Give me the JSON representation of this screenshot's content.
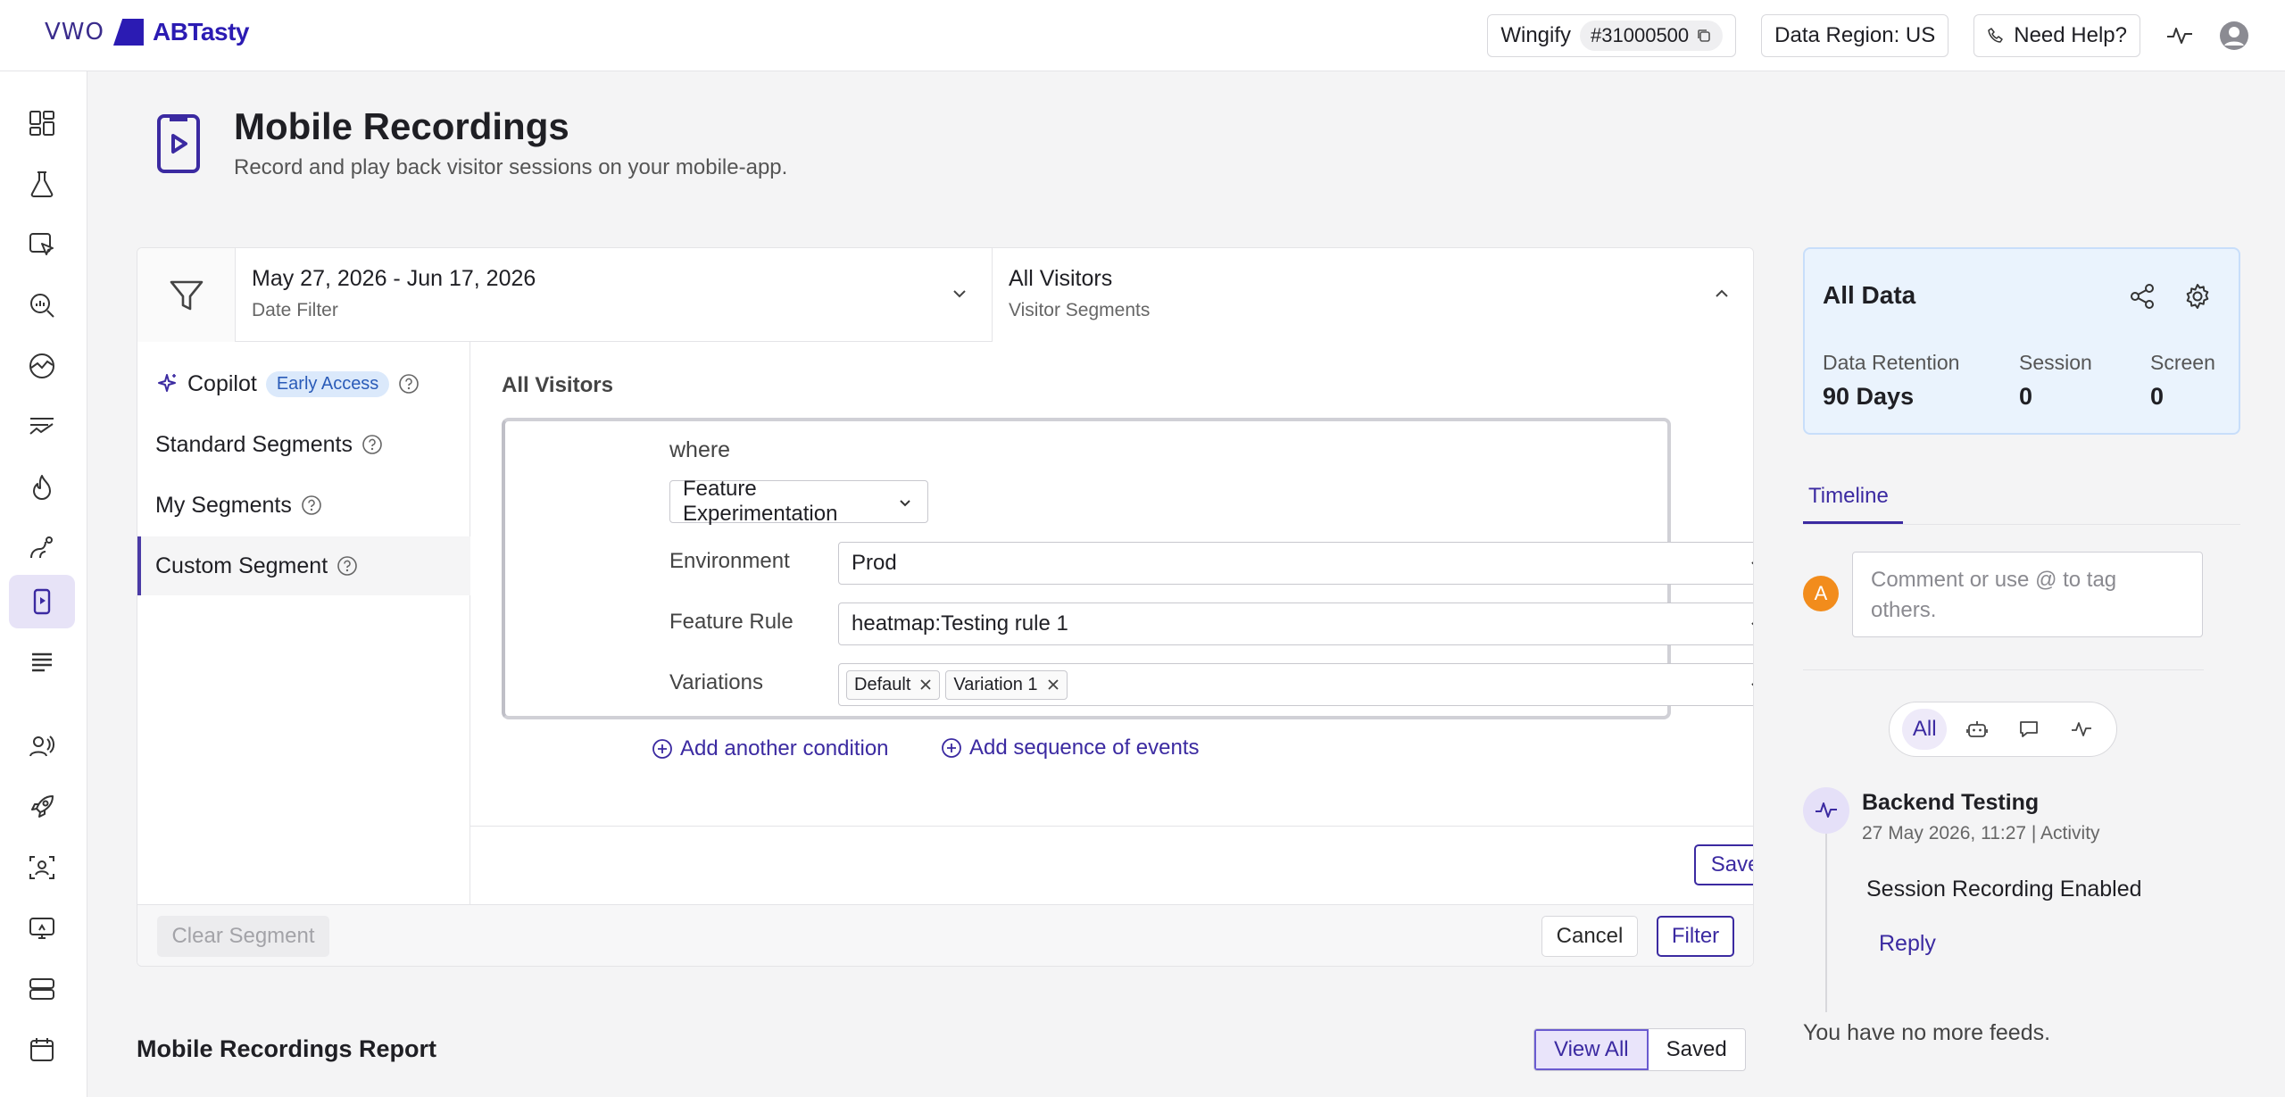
{
  "brand": {
    "vwo": "VWO",
    "abtasty": "ABTasty"
  },
  "topbar": {
    "account_name": "Wingify",
    "account_id": "#31000500",
    "data_region": "Data Region: US",
    "help": "Need Help?"
  },
  "sidebar": {
    "items": [
      {
        "icon": "dashboard-icon"
      },
      {
        "icon": "flask-icon"
      },
      {
        "icon": "cursor-select-icon"
      },
      {
        "icon": "insights-search-icon"
      },
      {
        "icon": "analytics-gauge-icon"
      },
      {
        "icon": "funnel-lines-icon"
      },
      {
        "icon": "flame-icon"
      },
      {
        "icon": "journey-icon"
      },
      {
        "icon": "mobile-recording-icon",
        "active": true
      },
      {
        "icon": "list-icon"
      },
      {
        "icon": "audience-icon"
      },
      {
        "icon": "rocket-icon"
      },
      {
        "icon": "personalize-icon"
      },
      {
        "icon": "deploy-screen-icon"
      },
      {
        "icon": "server-icon"
      },
      {
        "icon": "calendar-icon"
      }
    ]
  },
  "page": {
    "title": "Mobile Recordings",
    "subtitle": "Record and play back visitor sessions on your mobile-app."
  },
  "filter": {
    "date_range": "May 27, 2026 - Jun 17, 2026",
    "date_label": "Date Filter",
    "segment_value": "All Visitors",
    "segment_label": "Visitor Segments"
  },
  "segments_menu": {
    "copilot": "Copilot",
    "early_access": "Early Access",
    "standard": "Standard Segments",
    "my": "My Segments",
    "custom": "Custom Segment"
  },
  "segment_editor": {
    "heading": "All Visitors",
    "where": "where",
    "type_select": "Feature Experimentation",
    "environment_label": "Environment",
    "environment_value": "Prod",
    "feature_rule_label": "Feature Rule",
    "feature_rule_value": "heatmap:Testing rule 1",
    "variations_label": "Variations",
    "variations": [
      "Default",
      "Variation 1"
    ],
    "add_condition": "Add another condition",
    "add_sequence": "Add sequence of events",
    "save_segment": "Save Segment"
  },
  "footer_actions": {
    "clear": "Clear Segment",
    "cancel": "Cancel",
    "filter": "Filter"
  },
  "report": {
    "title": "Mobile Recordings Report",
    "view_all": "View All",
    "saved": "Saved"
  },
  "right_panel": {
    "title": "All Data",
    "retention_label": "Data Retention",
    "retention_value": "90 Days",
    "session_label": "Session",
    "session_value": "0",
    "screen_label": "Screen",
    "screen_value": "0",
    "timeline_tab": "Timeline",
    "avatar_initial": "A",
    "comment_placeholder": "Comment or use @ to tag others.",
    "filter_all": "All",
    "feed": {
      "title": "Backend Testing",
      "meta": "27 May 2026, 11:27 | Activity",
      "body": "Session Recording Enabled",
      "reply": "Reply"
    },
    "no_more": "You have no more feeds."
  },
  "colors": {
    "accent": "#3b2aa1",
    "avatar": "#f28c1c",
    "card_bg": "#eaf3fd"
  }
}
